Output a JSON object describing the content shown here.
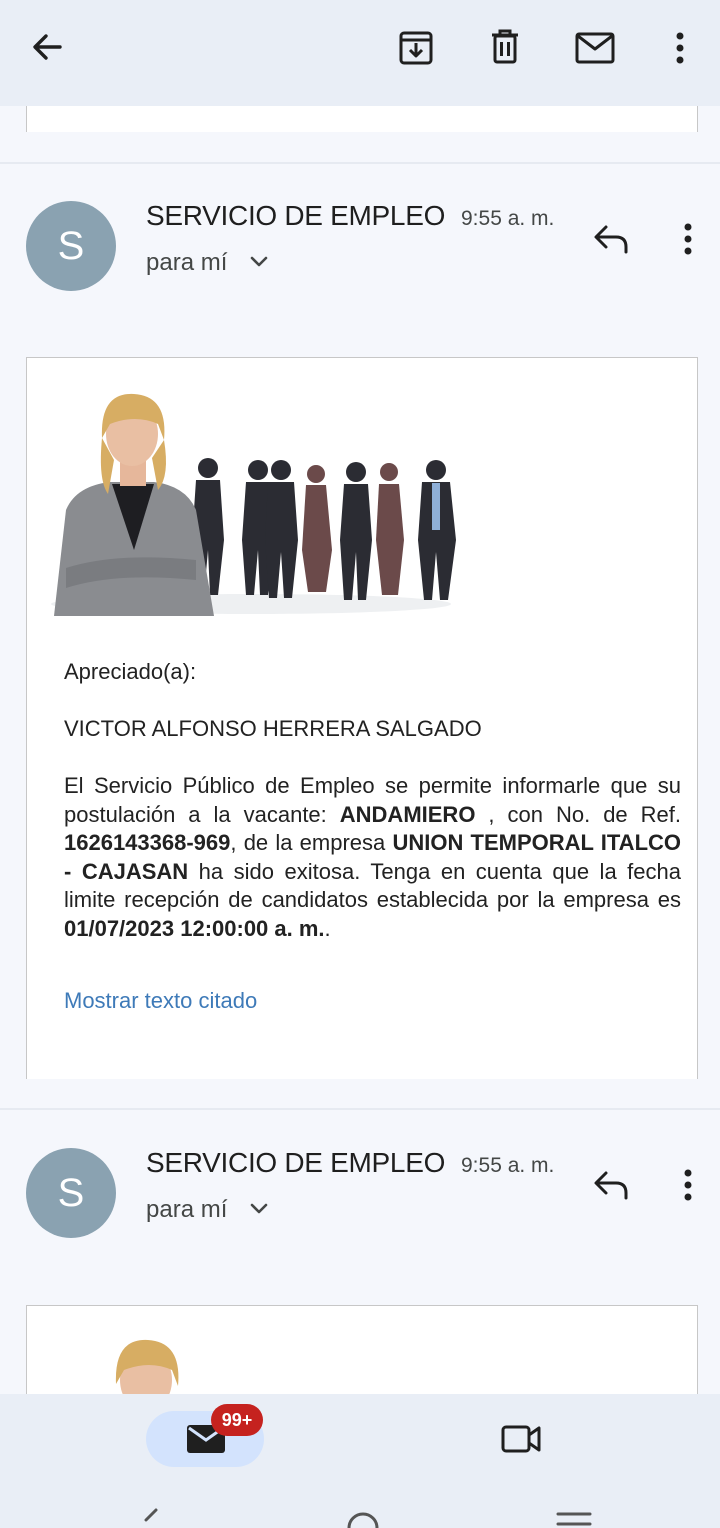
{
  "toolbar": {
    "back_icon": "arrow-back-icon",
    "archive_icon": "archive-icon",
    "delete_icon": "trash-icon",
    "mark_unread_icon": "mail-icon",
    "more_icon": "more-vert-icon"
  },
  "messages": [
    {
      "avatar_letter": "S",
      "sender": "SERVICIO DE EMPLEO",
      "time": "9:55 a. m.",
      "recipient": "para mí",
      "greeting": "Apreciado(a):",
      "name": "VICTOR ALFONSO HERRERA SALGADO",
      "body": {
        "p1": "El Servicio Público de Empleo se permite informarle que su postulación a la vacante: ",
        "vacancy": "ANDAMIERO",
        "p2": " , con No. de Ref. ",
        "ref": "1626143368-969",
        "p3": ", de la empresa ",
        "company": "UNION TEMPORAL ITALCO - CAJASAN",
        "p4": " ha sido exitosa. Tenga en cuenta que la fecha limite recepción de candidatos establecida por la empresa es ",
        "deadline": "01/07/2023 12:00:00 a. m.",
        "p5": "."
      },
      "show_quoted": "Mostrar texto citado"
    },
    {
      "avatar_letter": "S",
      "sender": "SERVICIO DE EMPLEO",
      "time": "9:55 a. m.",
      "recipient": "para mí"
    }
  ],
  "bottom_nav": {
    "mail_badge": "99+",
    "mail_icon": "mail-icon",
    "meet_icon": "video-camera-icon"
  },
  "colors": {
    "toolbar_bg": "#e9eef6",
    "avatar_bg": "#8aa2b1",
    "link": "#3e7ab8",
    "badge": "#c5221f",
    "mail_pill": "#d3e3fd"
  }
}
